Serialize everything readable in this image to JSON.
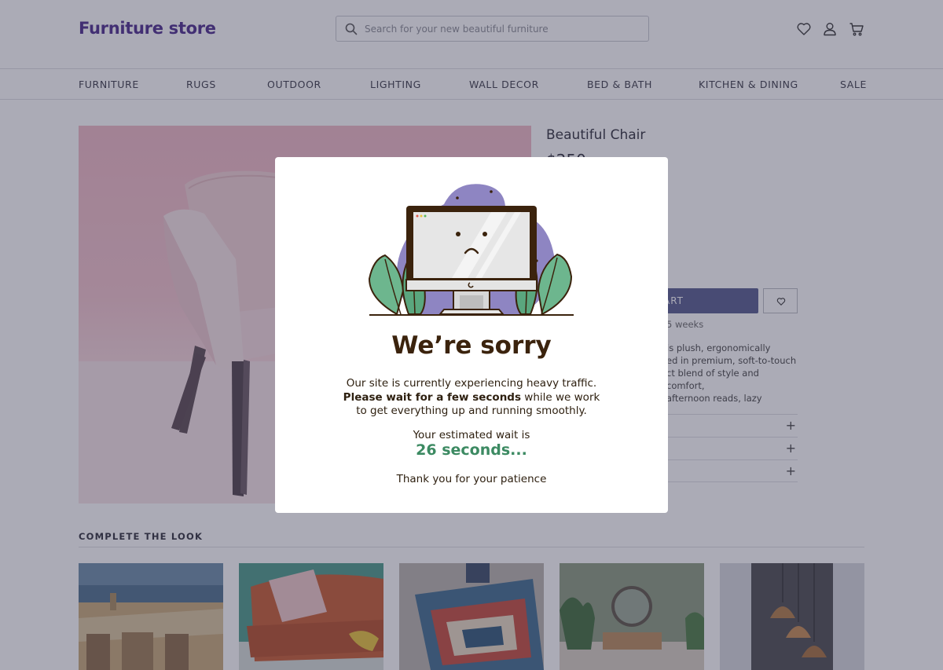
{
  "header": {
    "logo": "Furniture store",
    "search_placeholder": "Search for your new beautiful furniture"
  },
  "icons": {
    "search": "search-icon",
    "wishlist": "heart-icon",
    "account": "user-icon",
    "cart": "cart-icon"
  },
  "nav": {
    "items": [
      {
        "label": "FURNITURE"
      },
      {
        "label": "RUGS"
      },
      {
        "label": "OUTDOOR"
      },
      {
        "label": "LIGHTING"
      },
      {
        "label": "WALL DECOR"
      },
      {
        "label": "BED & BATH"
      },
      {
        "label": "KITCHEN & DINING"
      },
      {
        "label": "SALE"
      }
    ]
  },
  "product": {
    "title": "Beautiful Chair",
    "price_partial": "$250",
    "add_button_partial": "ART",
    "shipping_partial": "5 weeks",
    "description_lines": [
      "is plush, ergonomically",
      "ed in premium, soft-to-touch",
      "ct blend of style and comfort,",
      "afternoon reads, lazy"
    ]
  },
  "complete_the_look": {
    "title": "COMPLETE THE LOOK"
  },
  "modal": {
    "heading": "We’re sorry",
    "message_part1": "Our site is currently experiencing heavy traffic. ",
    "message_bold": "Please wait for a few seconds",
    "message_part2": " while we work to get everything up and running smoothly.",
    "wait_label": "Your estimated wait is",
    "wait_value": "26 seconds...",
    "thanks": "Thank you for your patience"
  },
  "colors": {
    "brand": "#4b2a8c",
    "accent_button": "#555a8e",
    "wait_value": "#3c8a62",
    "heading": "#3b230d"
  }
}
